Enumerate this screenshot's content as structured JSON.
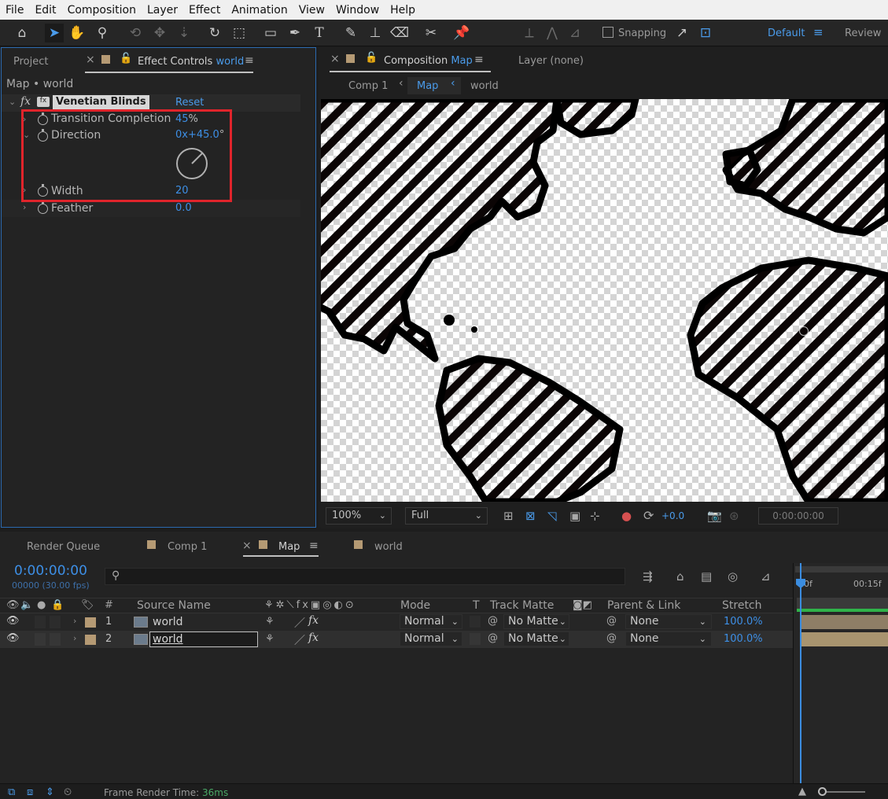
{
  "menu": [
    "File",
    "Edit",
    "Composition",
    "Layer",
    "Effect",
    "Animation",
    "View",
    "Window",
    "Help"
  ],
  "toolbar": {
    "snapping_label": "Snapping",
    "workspace_active": "Default",
    "workspace_other": "Review"
  },
  "effect_panel": {
    "project_tab": "Project",
    "effect_tab_prefix": "Effect Controls",
    "effect_tab_layer": "world",
    "breadcrumb": "Map • world",
    "effect_name": "Venetian Blinds",
    "reset_label": "Reset",
    "properties": [
      {
        "label": "Transition Completion",
        "value": "45",
        "unit": "%"
      },
      {
        "label": "Direction",
        "value_prefix": "0",
        "value": "x+45.0",
        "unit": "°"
      },
      {
        "label": "Width",
        "value": "20"
      },
      {
        "label": "Feather",
        "value": "0.0"
      }
    ],
    "highlight_color": "#e0242b"
  },
  "comp_panel": {
    "comp_tab_prefix": "Composition",
    "comp_tab_name": "Map",
    "layer_tab": "Layer (none)",
    "crumbs": [
      "Comp 1",
      "Map",
      "world"
    ],
    "zoom": "100%",
    "resolution": "Full",
    "exposure": "+0.0",
    "timecode": "0:00:00:00"
  },
  "timeline": {
    "tabs": [
      "Render Queue",
      "Comp 1",
      "Map",
      "world"
    ],
    "active_tab": "Map",
    "timecode": "0:00:00:00",
    "frame_info": "00000 (30.00 fps)",
    "search_placeholder": "",
    "columns": {
      "num": "#",
      "source": "Source Name",
      "mode": "Mode",
      "t": "T",
      "track_matte": "Track Matte",
      "parent": "Parent & Link",
      "stretch": "Stretch"
    },
    "ruler": [
      "00f",
      "00:15f"
    ],
    "layers": [
      {
        "num": "1",
        "name": "world",
        "mode": "Normal",
        "matte": "No Matte",
        "parent": "None",
        "stretch": "100.0%"
      },
      {
        "num": "2",
        "name": "world",
        "mode": "Normal",
        "matte": "No Matte",
        "parent": "None",
        "stretch": "100.0%"
      }
    ]
  },
  "status": {
    "label": "Frame Render Time:",
    "value": "36ms"
  },
  "colors": {
    "accent": "#4a9bea",
    "label_tan": "#b59a74"
  }
}
